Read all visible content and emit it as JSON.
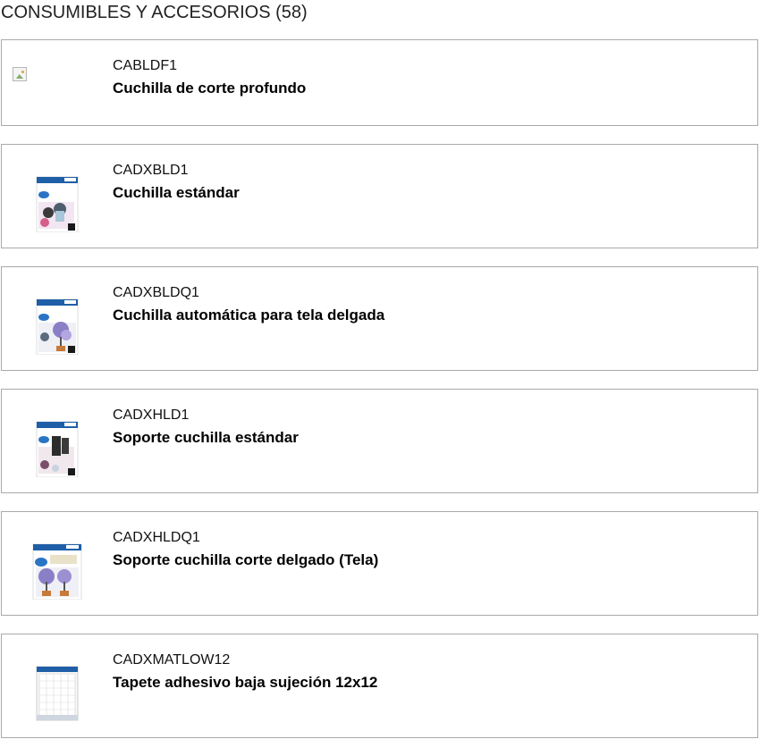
{
  "section": {
    "title": "CONSUMIBLES Y ACCESORIOS (58)"
  },
  "products": [
    {
      "code": "CABLDF1",
      "name": "Cuchilla de corte profundo",
      "image": "broken-image-icon"
    },
    {
      "code": "CADXBLD1",
      "name": "Cuchilla estándar",
      "image": "blade-package-icon"
    },
    {
      "code": "CADXBLDQ1",
      "name": "Cuchilla automática para tela delgada",
      "image": "blade-package-icon"
    },
    {
      "code": "CADXHLD1",
      "name": "Soporte cuchilla estándar",
      "image": "holder-package-icon"
    },
    {
      "code": "CADXHLDQ1",
      "name": "Soporte cuchilla corte delgado (Tela)",
      "image": "holder-package-icon"
    },
    {
      "code": "CADXMATLOW12",
      "name": "Tapete adhesivo baja sujeción 12x12",
      "image": "mat-package-icon"
    }
  ],
  "colors": {
    "card_border": "#a9a9a9",
    "package_blue": "#1f5fa8",
    "package_flowers": "#8a7fc6"
  }
}
